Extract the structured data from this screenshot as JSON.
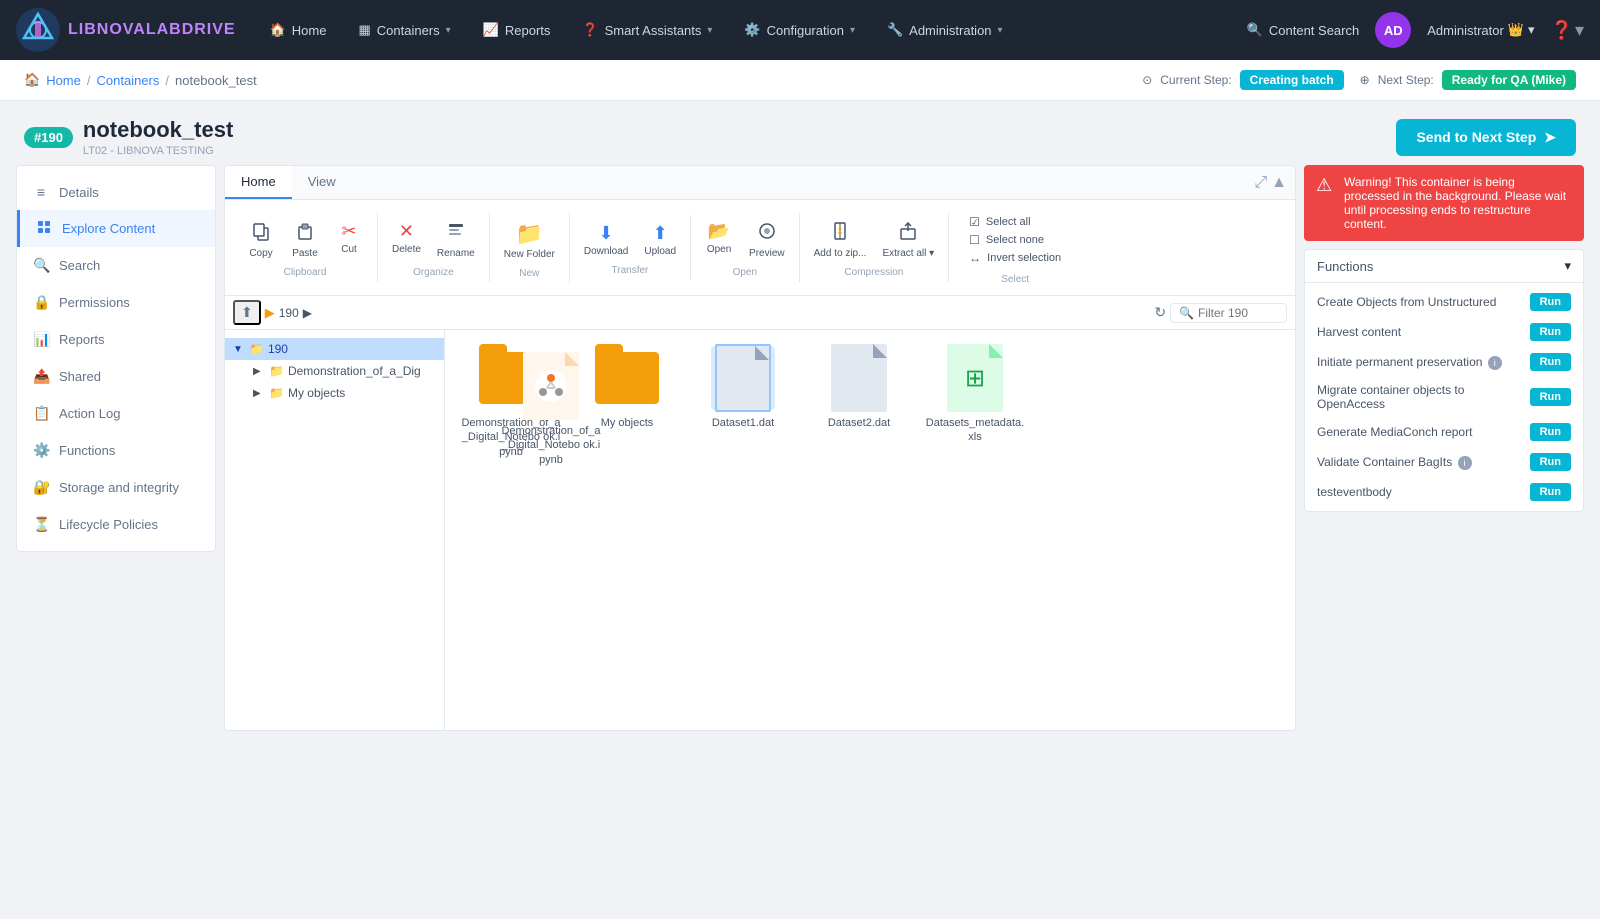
{
  "app": {
    "logo_text_main": "LIBNOVA",
    "logo_text_accent": "LABDRIVE"
  },
  "topnav": {
    "items": [
      {
        "label": "Home",
        "icon": "🏠",
        "has_chevron": false
      },
      {
        "label": "Containers",
        "icon": "📋",
        "has_chevron": true
      },
      {
        "label": "Reports",
        "icon": "📈",
        "has_chevron": false
      },
      {
        "label": "Smart Assistants",
        "icon": "❓",
        "has_chevron": true
      },
      {
        "label": "Configuration",
        "icon": "⚙️",
        "has_chevron": true
      },
      {
        "label": "Administration",
        "icon": "🔧",
        "has_chevron": true
      }
    ],
    "content_search": "Content Search",
    "user_initials": "AD",
    "user_name": "Administrator"
  },
  "breadcrumb": {
    "home": "Home",
    "containers": "Containers",
    "current": "notebook_test"
  },
  "steps": {
    "current_label": "Current Step:",
    "current_value": "Creating batch",
    "next_label": "Next Step:",
    "next_value": "Ready for QA (Mike)"
  },
  "container": {
    "id": "#190",
    "name": "notebook_test",
    "subtitle": "LT02 - LIBNOVA TESTING",
    "send_btn": "Send to Next Step"
  },
  "sidebar": {
    "items": [
      {
        "label": "Details",
        "icon": "≡",
        "active": false
      },
      {
        "label": "Explore Content",
        "icon": "🔍",
        "active": true
      },
      {
        "label": "Search",
        "icon": "🔎",
        "active": false
      },
      {
        "label": "Permissions",
        "icon": "🔒",
        "active": false
      },
      {
        "label": "Reports",
        "icon": "📊",
        "active": false
      },
      {
        "label": "Shared",
        "icon": "📤",
        "active": false
      },
      {
        "label": "Action Log",
        "icon": "📋",
        "active": false
      },
      {
        "label": "Functions",
        "icon": "⚙️",
        "active": false
      },
      {
        "label": "Storage and integrity",
        "icon": "🔐",
        "active": false
      },
      {
        "label": "Lifecycle Policies",
        "icon": "⏳",
        "active": false
      }
    ]
  },
  "toolbar": {
    "tabs": [
      "Home",
      "View"
    ],
    "groups": [
      {
        "label": "Clipboard",
        "buttons": [
          {
            "label": "Copy",
            "icon": "copy",
            "disabled": false
          },
          {
            "label": "Paste",
            "icon": "paste",
            "disabled": false
          },
          {
            "label": "Cut",
            "icon": "cut",
            "disabled": false
          }
        ]
      },
      {
        "label": "Organize",
        "buttons": [
          {
            "label": "Delete",
            "icon": "delete",
            "disabled": false
          },
          {
            "label": "Rename",
            "icon": "rename",
            "disabled": false
          }
        ]
      },
      {
        "label": "New",
        "buttons": [
          {
            "label": "New Folder",
            "icon": "new_folder",
            "disabled": false
          }
        ]
      },
      {
        "label": "Transfer",
        "buttons": [
          {
            "label": "Download",
            "icon": "download",
            "disabled": false
          },
          {
            "label": "Upload",
            "icon": "upload",
            "disabled": false
          }
        ]
      },
      {
        "label": "Open",
        "buttons": [
          {
            "label": "Open",
            "icon": "open",
            "disabled": false
          },
          {
            "label": "Preview",
            "icon": "preview",
            "disabled": false
          }
        ]
      },
      {
        "label": "Compression",
        "buttons": [
          {
            "label": "Add to zip...",
            "icon": "zip",
            "disabled": false
          },
          {
            "label": "Extract all ▾",
            "icon": "extract",
            "disabled": false
          }
        ]
      },
      {
        "label": "Select",
        "select_items": [
          {
            "label": "Select all"
          },
          {
            "label": "Select none"
          },
          {
            "label": "Invert selection"
          }
        ]
      }
    ]
  },
  "file_nav": {
    "path": "190",
    "filter_placeholder": "Filter 190"
  },
  "file_tree": {
    "root": "190",
    "items": [
      {
        "label": "Demonstration_of_a_Dig",
        "expanded": false
      },
      {
        "label": "My objects",
        "expanded": false
      }
    ]
  },
  "files": [
    {
      "name": "Demonstration_of_a_Digital_Notebo ok.ipynb",
      "type": "folder"
    },
    {
      "name": "My objects",
      "type": "folder"
    },
    {
      "name": "Dataset1.dat",
      "type": "dat",
      "selected": true
    },
    {
      "name": "Dataset2.dat",
      "type": "dat"
    },
    {
      "name": "Datasets_metadata.xls",
      "type": "xls"
    },
    {
      "name": "Demonstration_of_a_Digital_Notebo ok.ipynb",
      "type": "ipynb"
    }
  ],
  "warning": {
    "text": "Warning! This container is being processed in the background. Please wait until processing ends to restructure content."
  },
  "functions_panel": {
    "title": "Functions",
    "items": [
      {
        "label": "Create Objects from Unstructured",
        "btn": "Run"
      },
      {
        "label": "Harvest content",
        "btn": "Run"
      },
      {
        "label": "Initiate permanent preservation",
        "btn": "Run",
        "has_info": true
      },
      {
        "label": "Migrate container objects to OpenAccess",
        "btn": "Run"
      },
      {
        "label": "Generate MediaConch report",
        "btn": "Run"
      },
      {
        "label": "Validate Container BagIts",
        "btn": "Run",
        "has_info": true
      },
      {
        "label": "testeventbody",
        "btn": "Run"
      }
    ]
  }
}
